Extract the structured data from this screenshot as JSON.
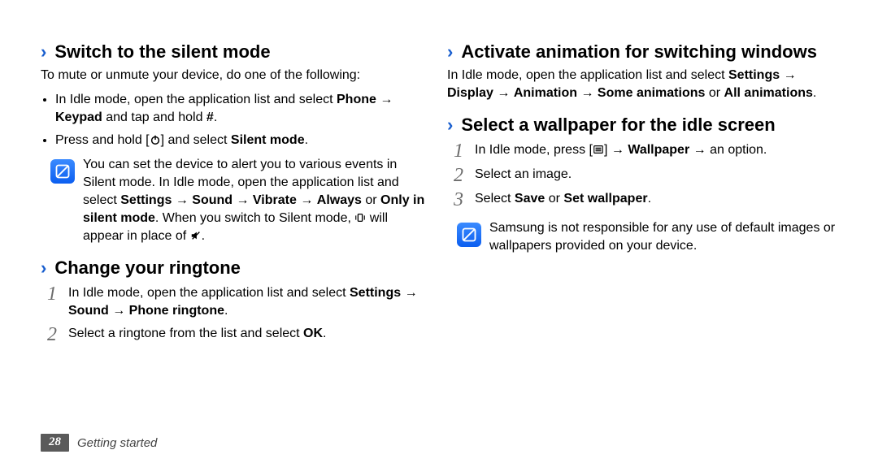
{
  "left": {
    "s1": {
      "title": "Switch to the silent mode",
      "intro": "To mute or unmute your device, do one of the following:",
      "bul1a": "In Idle mode, open the application list and select ",
      "bul1b": "Phone",
      "bul1c": " → ",
      "bul1d": "Keypad",
      "bul1e": " and tap and hold ",
      "bul1f": "#",
      "bul1g": ".",
      "bul2a": "Press and hold [",
      "bul2b": "] and select ",
      "bul2c": "Silent mode",
      "bul2d": ".",
      "note1": "You can set the device to alert you to various events in Silent mode. In Idle mode, open the application list and select ",
      "note2": "Settings",
      "note3": " → ",
      "note4": "Sound",
      "note5": " → ",
      "note6": "Vibrate",
      "note7": " → ",
      "note8": "Always",
      "note9": " or ",
      "note10": "Only in silent mode",
      "note11": ". When you switch to Silent mode, ",
      "note12": " will appear in place of ",
      "note13": "."
    },
    "s2": {
      "title": "Change your ringtone",
      "st1a": "In Idle mode, open the application list and select ",
      "st1b": "Settings",
      "st1c": " → ",
      "st1d": "Sound",
      "st1e": " → ",
      "st1f": "Phone ringtone",
      "st1g": ".",
      "st2a": "Select a ringtone from the list and select ",
      "st2b": "OK",
      "st2c": "."
    }
  },
  "right": {
    "s1": {
      "title": "Activate animation for switching windows",
      "p1": "In Idle mode, open the application list and select ",
      "p2": "Settings",
      "p3": " → ",
      "p4": "Display",
      "p5": " → ",
      "p6": "Animation",
      "p7": " → ",
      "p8": "Some animations",
      "p9": " or ",
      "p10": "All animations",
      "p11": "."
    },
    "s2": {
      "title": "Select a wallpaper for the idle screen",
      "st1a": "In Idle mode, press [",
      "st1b": "] → ",
      "st1c": "Wallpaper",
      "st1d": " → an option.",
      "st2": "Select an image.",
      "st3a": "Select ",
      "st3b": "Save",
      "st3c": " or ",
      "st3d": "Set wallpaper",
      "st3e": ".",
      "note": "Samsung is not responsible for any use of default images or wallpapers provided on your device."
    }
  },
  "footer": {
    "page": "28",
    "section": "Getting started"
  }
}
